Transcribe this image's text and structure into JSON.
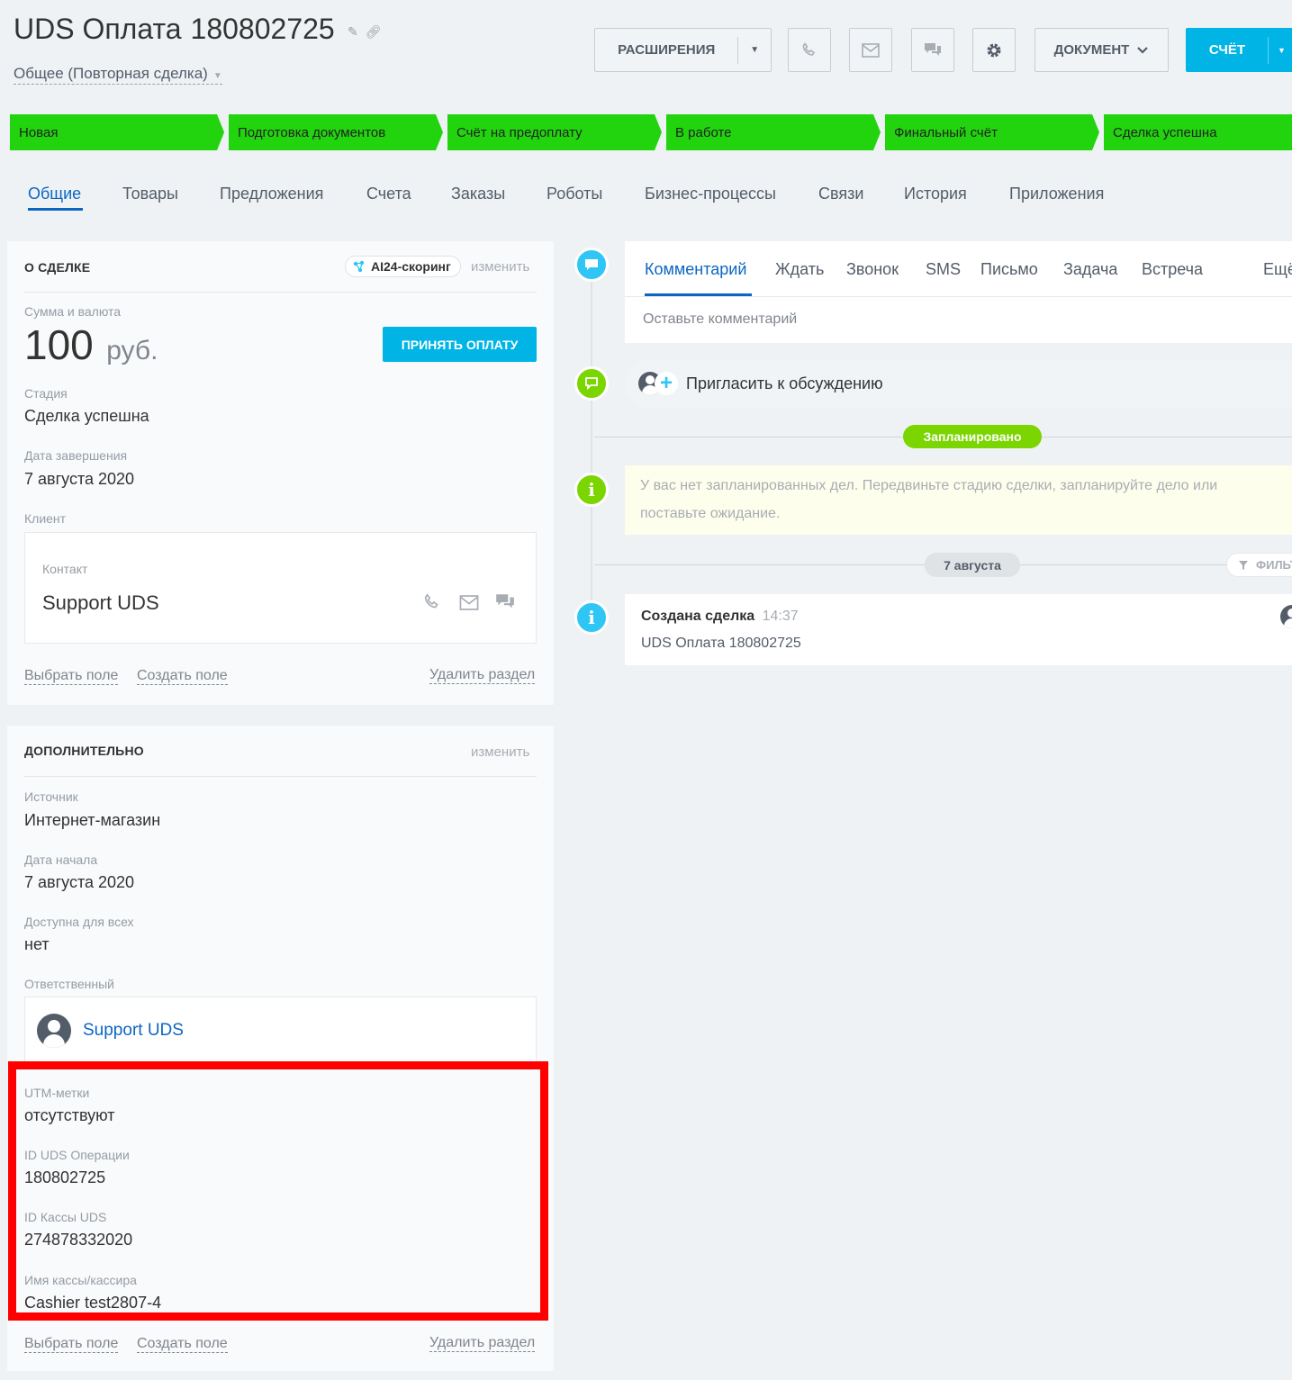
{
  "header": {
    "title": "UDS Оплата",
    "deal_number": "180802725",
    "category": "Общее (Повторная сделка)",
    "buttons": {
      "extensions": "РАСШИРЕНИЯ",
      "document": "ДОКУМЕНТ",
      "invoice": "СЧЁТ"
    }
  },
  "stages": [
    "Новая",
    "Подготовка документов",
    "Счёт на предоплату",
    "В работе",
    "Финальный счёт",
    "Сделка успешна"
  ],
  "tabs": [
    "Общие",
    "Товары",
    "Предложения",
    "Счета",
    "Заказы",
    "Роботы",
    "Бизнес-процессы",
    "Связи",
    "История",
    "Приложения"
  ],
  "about": {
    "heading": "О СДЕЛКЕ",
    "scoring": "AI24-скоринг",
    "edit": "изменить",
    "amount_label": "Сумма и валюта",
    "amount": "100",
    "currency": "руб.",
    "accept_payment": "ПРИНЯТЬ ОПЛАТУ",
    "stage_label": "Стадия",
    "stage_value": "Сделка успешна",
    "close_date_label": "Дата завершения",
    "close_date": "7 августа 2020",
    "client_label": "Клиент",
    "contact_label": "Контакт",
    "contact_name": "Support UDS",
    "select_field": "Выбрать поле",
    "create_field": "Создать поле",
    "delete_section": "Удалить раздел"
  },
  "additional": {
    "heading": "ДОПОЛНИТЕЛЬНО",
    "edit": "изменить",
    "source_label": "Источник",
    "source": "Интернет-магазин",
    "start_date_label": "Дата начала",
    "start_date": "7 августа 2020",
    "available_label": "Доступна для всех",
    "available": "нет",
    "responsible_label": "Ответственный",
    "responsible": "Support UDS",
    "utm_label": "UTM-метки",
    "utm": "отсутствуют",
    "uds_op_label": "ID UDS Операции",
    "uds_op": "180802725",
    "cash_id_label": "ID Кассы UDS",
    "cash_id": "274878332020",
    "cashier_label": "Имя кассы/кассира",
    "cashier": "Cashier test2807-4",
    "select_field": "Выбрать поле",
    "create_field": "Создать поле",
    "delete_section": "Удалить раздел"
  },
  "timeline": {
    "tabs": [
      "Комментарий",
      "Ждать",
      "Звонок",
      "SMS",
      "Письмо",
      "Задача",
      "Встреча",
      "Ещё"
    ],
    "comment_placeholder": "Оставьте комментарий",
    "invite": "Пригласить к обсуждению",
    "planned_badge": "Запланировано",
    "no_tasks": "У вас нет запланированных дел. Передвиньте стадию сделки, запланируйте дело или",
    "no_tasks_2": "поставьте ожидание.",
    "date_badge": "7 августа",
    "filter": "ФИЛЬТ",
    "event_title": "Создана сделка",
    "event_time": "14:37",
    "event_text": "UDS Оплата 180802725"
  },
  "colors": {
    "stage_green": "#22d40e",
    "accent_blue": "#00b4e6",
    "link_blue": "#0b66c3",
    "highlight_red": "#ff0000",
    "timeline_green": "#7bd500"
  }
}
